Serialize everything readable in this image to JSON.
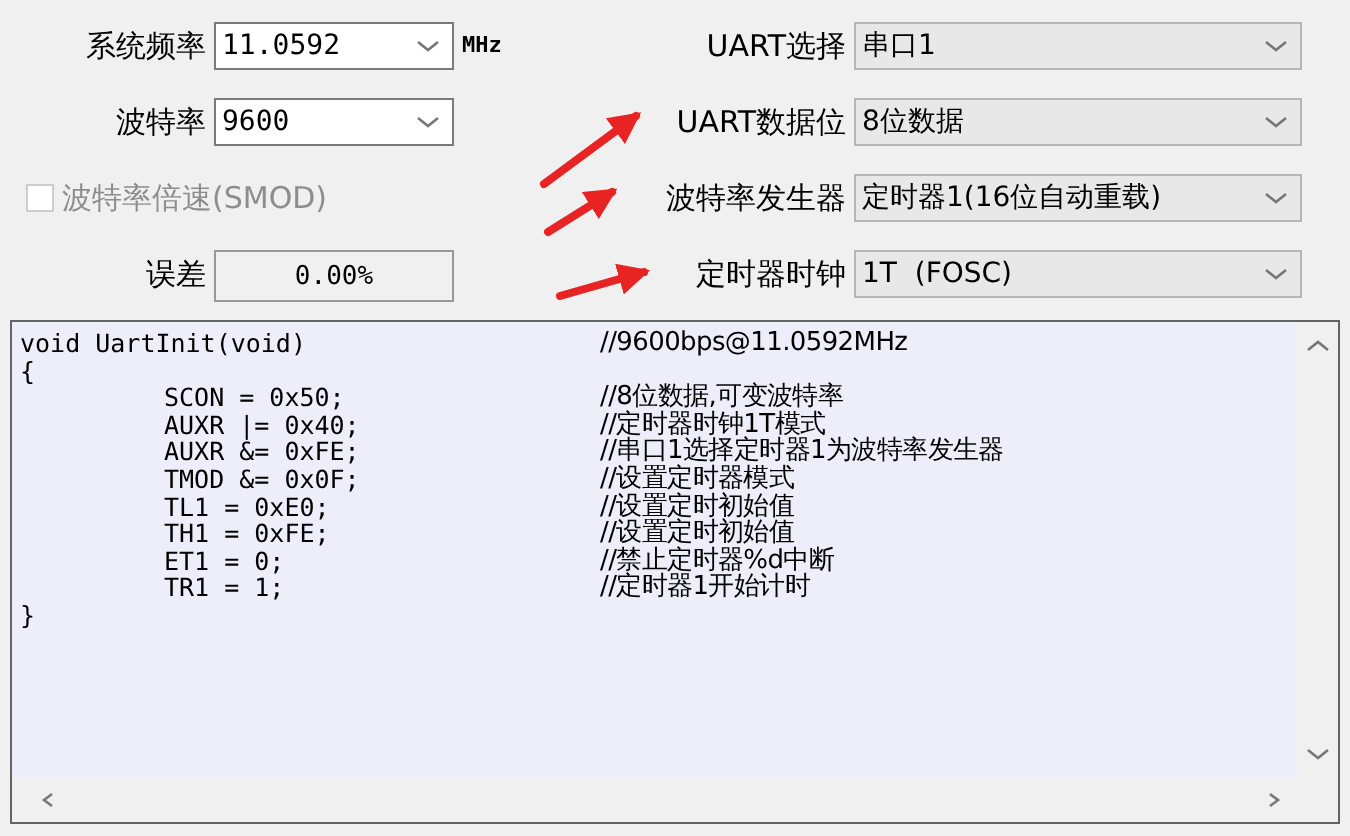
{
  "left_fields": [
    {
      "kind": "combo",
      "label": "系统频率",
      "value": "11.0592",
      "unit": "MHz"
    },
    {
      "kind": "combo",
      "label": "波特率",
      "value": "9600"
    },
    {
      "kind": "checkbox",
      "label": "波特率倍速(SMOD)",
      "checked": false,
      "disabled": true
    },
    {
      "kind": "readout",
      "label": "误差",
      "value": "0.00%"
    }
  ],
  "right_fields": [
    {
      "label": "UART选择",
      "value": "串口1"
    },
    {
      "label": "UART数据位",
      "value": "8位数据"
    },
    {
      "label": "波特率发生器",
      "value": "定时器1(16位自动重载)"
    },
    {
      "label": "定时器时钟",
      "value": "1T  (FOSC)"
    }
  ],
  "code": {
    "header": {
      "code": "void UartInit(void)",
      "comment": "//9600bps@11.0592MHz"
    },
    "open": "{",
    "body": [
      {
        "code": "SCON = 0x50;",
        "comment": "//8位数据,可变波特率"
      },
      {
        "code": "AUXR |= 0x40;",
        "comment": "//定时器时钟1T模式"
      },
      {
        "code": "AUXR &= 0xFE;",
        "comment": "//串口1选择定时器1为波特率发生器"
      },
      {
        "code": "TMOD &= 0x0F;",
        "comment": "//设置定时器模式"
      },
      {
        "code": "TL1 = 0xE0;",
        "comment": "//设置定时初始值"
      },
      {
        "code": "TH1 = 0xFE;",
        "comment": "//设置定时初始值"
      },
      {
        "code": "ET1 = 0;",
        "comment": "//禁止定时器%d中断"
      },
      {
        "code": "TR1 = 1;",
        "comment": "//定时器1开始计时"
      }
    ],
    "close": "}"
  }
}
